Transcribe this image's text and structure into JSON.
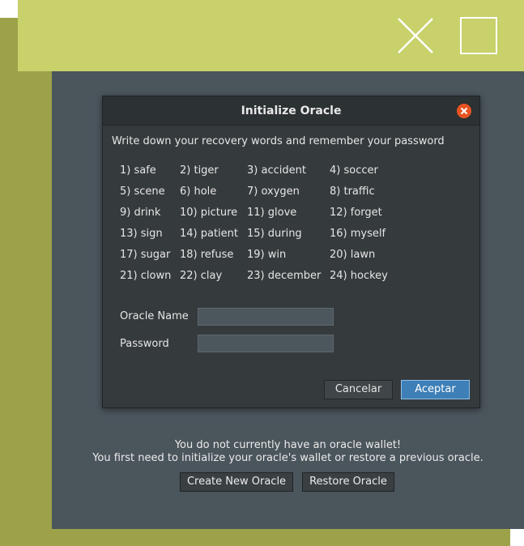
{
  "window": {
    "close_icon": "close-x-icon",
    "maximize_icon": "maximize-square-icon"
  },
  "dialog": {
    "title": "Initialize Oracle",
    "close_icon": "close-circle-icon",
    "instruction": "Write down your recovery words and remember your password",
    "words": [
      "1) safe",
      "2) tiger",
      "3) accident",
      "4) soccer",
      "5) scene",
      "6) hole",
      "7) oxygen",
      "8) traffic",
      "9) drink",
      "10) picture",
      "11) glove",
      "12) forget",
      "13) sign",
      "14) patient",
      "15) during",
      "16) myself",
      "17) sugar",
      "18) refuse",
      "19) win",
      "20) lawn",
      "21) clown",
      "22) clay",
      "23) december",
      "24) hockey"
    ],
    "oracle_name_label": "Oracle Name",
    "oracle_name_value": "",
    "password_label": "Password",
    "password_value": "",
    "cancel_label": "Cancelar",
    "accept_label": "Aceptar"
  },
  "main": {
    "message_line1": "You do not currently have an oracle wallet!",
    "message_line2": "You first need to initialize your oracle's wallet or restore a previous oracle.",
    "create_button": "Create New Oracle",
    "restore_button": "Restore Oracle"
  },
  "colors": {
    "top_bar": "#c8d16a",
    "olive_background": "#9da24a",
    "panel": "#4b555c",
    "dialog": "#353a3d",
    "accent": "#e95420",
    "primary_button": "#3d7fb6"
  }
}
